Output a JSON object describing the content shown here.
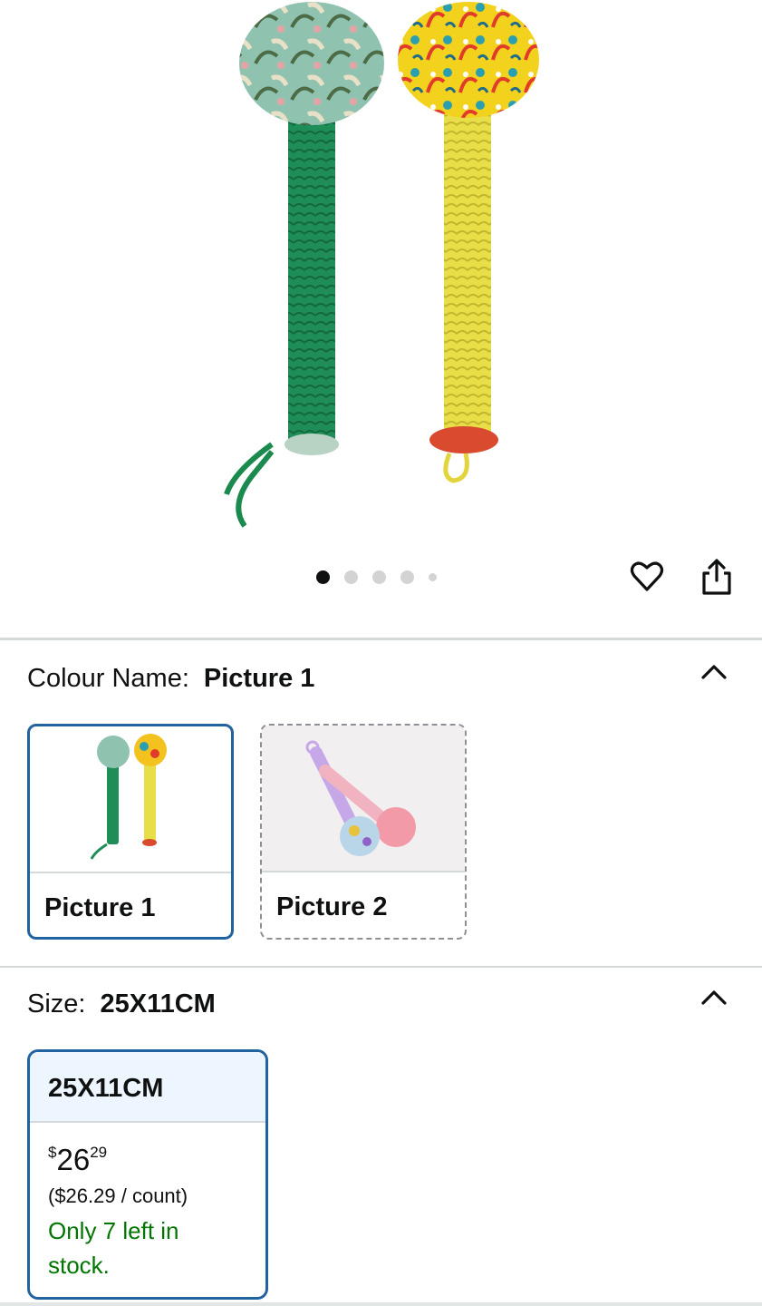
{
  "hero": {
    "image_icon": "maraca-product-photo",
    "dots_count": 5,
    "active_dot": 0
  },
  "actions": {
    "wishlist_icon": "heart-icon",
    "share_icon": "share-icon"
  },
  "colour": {
    "label": "Colour Name:",
    "selected": "Picture 1",
    "options": [
      {
        "label": "Picture 1",
        "selected": true
      },
      {
        "label": "Picture 2",
        "selected": false
      }
    ]
  },
  "size": {
    "label": "Size:",
    "selected": "25X11CM",
    "options": [
      {
        "label": "25X11CM",
        "price_symbol": "$",
        "price_whole": "26",
        "price_fraction": "29",
        "unit_price": "($26.29 / count)",
        "stock": "Only 7 left in stock.",
        "selected": true
      }
    ]
  },
  "colors": {
    "accent": "#2162a1",
    "stock_green": "#007600",
    "divider": "#d5d9d9"
  }
}
